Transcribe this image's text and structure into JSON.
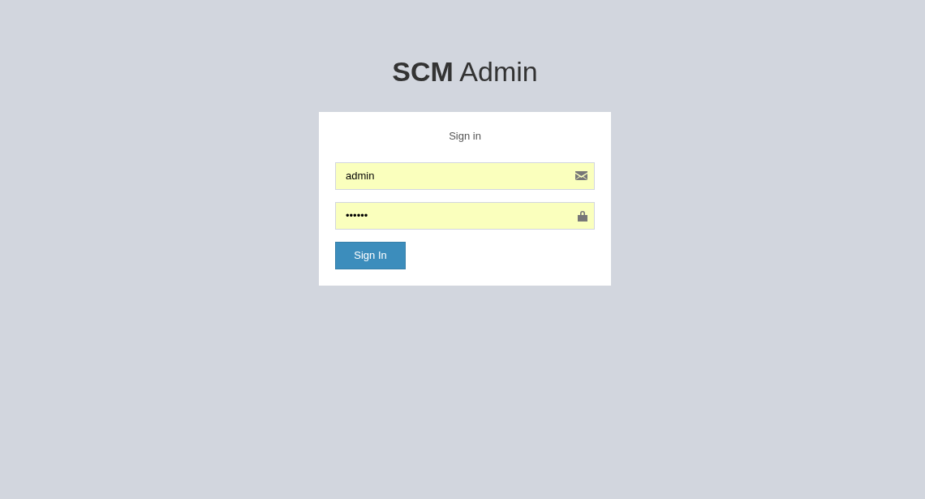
{
  "logo": "**SCM** Admin",
  "form": {
    "heading": "Sign in",
    "fields": [
      {
        "kind": "email",
        "value": "admin"
      },
      {
        "kind": "password",
        "value": "••••••"
      }
    ],
    "button": "Sign In"
  }
}
